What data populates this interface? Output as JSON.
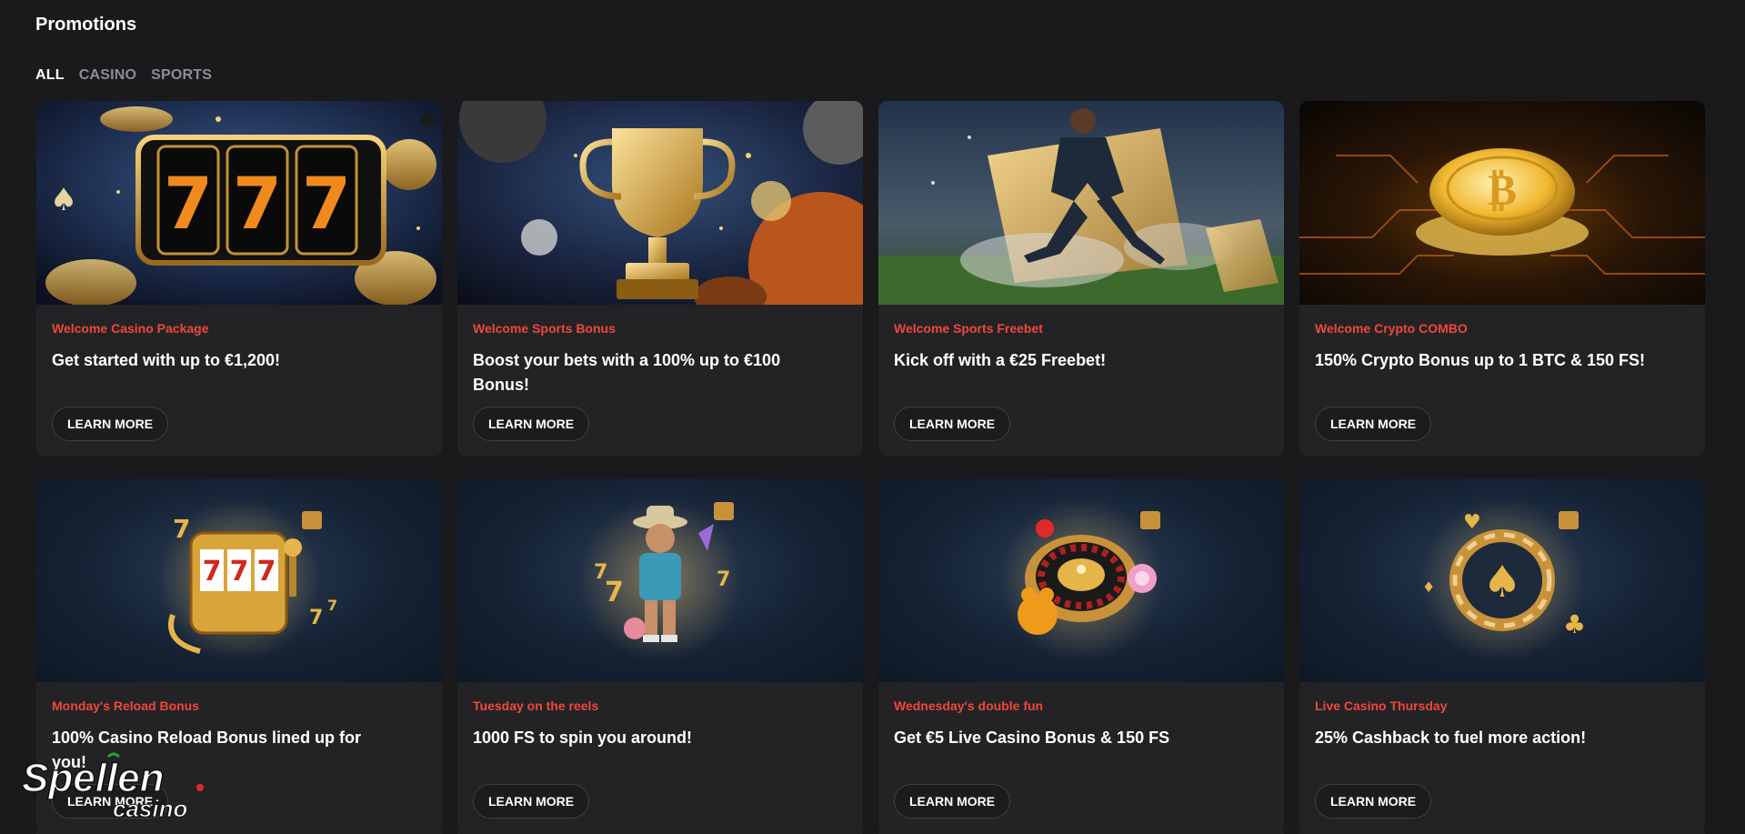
{
  "page": {
    "title": "Promotions"
  },
  "tabs": [
    {
      "label": "ALL",
      "active": true
    },
    {
      "label": "CASINO",
      "active": false
    },
    {
      "label": "SPORTS",
      "active": false
    }
  ],
  "cards": [
    {
      "category": "Welcome Casino Package",
      "title": "Get started with up to €1,200!",
      "button": "LEARN MORE",
      "image_icon": "slot-reels-777-icon"
    },
    {
      "category": "Welcome Sports Bonus",
      "title": "Boost your bets with a 100% up to €100 Bonus!",
      "button": "LEARN MORE",
      "image_icon": "trophy-icon"
    },
    {
      "category": "Welcome Sports Freebet",
      "title": "Kick off with a €25 Freebet!",
      "button": "LEARN MORE",
      "image_icon": "football-player-icon"
    },
    {
      "category": "Welcome Crypto COMBO",
      "title": "150% Crypto Bonus up to 1 BTC & 150 FS!",
      "button": "LEARN MORE",
      "image_icon": "bitcoin-coin-icon"
    },
    {
      "category": "Monday's Reload Bonus",
      "title": "100% Casino Reload Bonus lined up for you!",
      "button": "LEARN MORE",
      "image_icon": "slot-machine-icon"
    },
    {
      "category": "Tuesday on the reels",
      "title": "1000 FS to spin you around!",
      "button": "LEARN MORE",
      "image_icon": "cowboy-character-icon"
    },
    {
      "category": "Wednesday's double fun",
      "title": "Get €5 Live Casino Bonus & 150 FS",
      "button": "LEARN MORE",
      "image_icon": "roulette-wheel-icon"
    },
    {
      "category": "Live Casino Thursday",
      "title": "25% Cashback to fuel more action!",
      "button": "LEARN MORE",
      "image_icon": "casino-chip-icon"
    }
  ],
  "watermark": {
    "text_main": "Spellen",
    "text_sub": "casino"
  },
  "colors": {
    "background": "#1a1a1c",
    "card": "#232326",
    "accent_red": "#f0473a",
    "gold": "#e6b54a"
  }
}
